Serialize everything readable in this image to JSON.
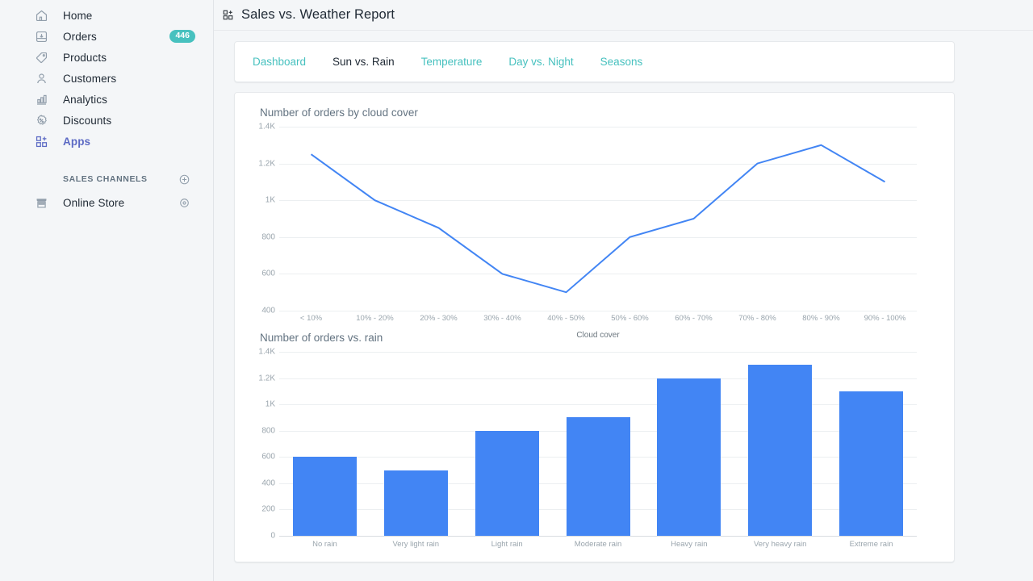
{
  "sidebar": {
    "items": [
      {
        "label": "Home",
        "icon": "home-icon",
        "badge": null,
        "active": false
      },
      {
        "label": "Orders",
        "icon": "orders-icon",
        "badge": "446",
        "active": false
      },
      {
        "label": "Products",
        "icon": "tag-icon",
        "badge": null,
        "active": false
      },
      {
        "label": "Customers",
        "icon": "person-icon",
        "badge": null,
        "active": false
      },
      {
        "label": "Analytics",
        "icon": "bar-chart-icon",
        "badge": null,
        "active": false
      },
      {
        "label": "Discounts",
        "icon": "discount-icon",
        "badge": null,
        "active": false
      },
      {
        "label": "Apps",
        "icon": "apps-icon",
        "badge": null,
        "active": true
      }
    ],
    "section": {
      "title": "SALES CHANNELS",
      "add_icon": "plus-circle-icon",
      "channels": [
        {
          "label": "Online Store",
          "icon": "store-icon",
          "action_icon": "eye-icon"
        }
      ]
    }
  },
  "header": {
    "icon": "apps-icon",
    "title": "Sales vs. Weather Report"
  },
  "tabs": [
    {
      "label": "Dashboard",
      "active": false
    },
    {
      "label": "Sun vs. Rain",
      "active": true
    },
    {
      "label": "Temperature",
      "active": false
    },
    {
      "label": "Day vs. Night",
      "active": false
    },
    {
      "label": "Seasons",
      "active": false
    }
  ],
  "colors": {
    "accent_teal": "#47c1bf",
    "accent_indigo": "#5c6ac4",
    "series_blue": "#4285f4",
    "page_bg": "#f4f6f8",
    "text_dark": "#212b36",
    "text_muted": "#637381"
  },
  "chart_data": [
    {
      "type": "line",
      "title": "Number of orders by cloud cover",
      "xlabel": "Cloud cover",
      "ylabel": "",
      "categories": [
        "< 10%",
        "10% - 20%",
        "20% - 30%",
        "30% - 40%",
        "40% - 50%",
        "50% - 60%",
        "60% - 70%",
        "70% - 80%",
        "80% - 90%",
        "90% - 100%"
      ],
      "values": [
        1250,
        1000,
        850,
        600,
        500,
        800,
        900,
        1200,
        1300,
        1100
      ],
      "ylim": [
        400,
        1400
      ],
      "yticks": [
        400,
        600,
        800,
        1000,
        1200,
        1400
      ],
      "ytick_labels": [
        "400",
        "600",
        "800",
        "1K",
        "1.2K",
        "1.4K"
      ],
      "series_color": "#4285f4",
      "grid": true,
      "legend": "none"
    },
    {
      "type": "bar",
      "title": "Number of orders vs. rain",
      "xlabel": "",
      "ylabel": "",
      "categories": [
        "No rain",
        "Very light rain",
        "Light rain",
        "Moderate rain",
        "Heavy rain",
        "Very heavy rain",
        "Extreme rain"
      ],
      "values": [
        600,
        500,
        800,
        900,
        1200,
        1300,
        1100
      ],
      "ylim": [
        0,
        1400
      ],
      "yticks": [
        0,
        200,
        400,
        600,
        800,
        1000,
        1200,
        1400
      ],
      "ytick_labels": [
        "0",
        "200",
        "400",
        "600",
        "800",
        "1K",
        "1.2K",
        "1.4K"
      ],
      "series_color": "#4285f4",
      "grid": true,
      "legend": "none"
    }
  ]
}
